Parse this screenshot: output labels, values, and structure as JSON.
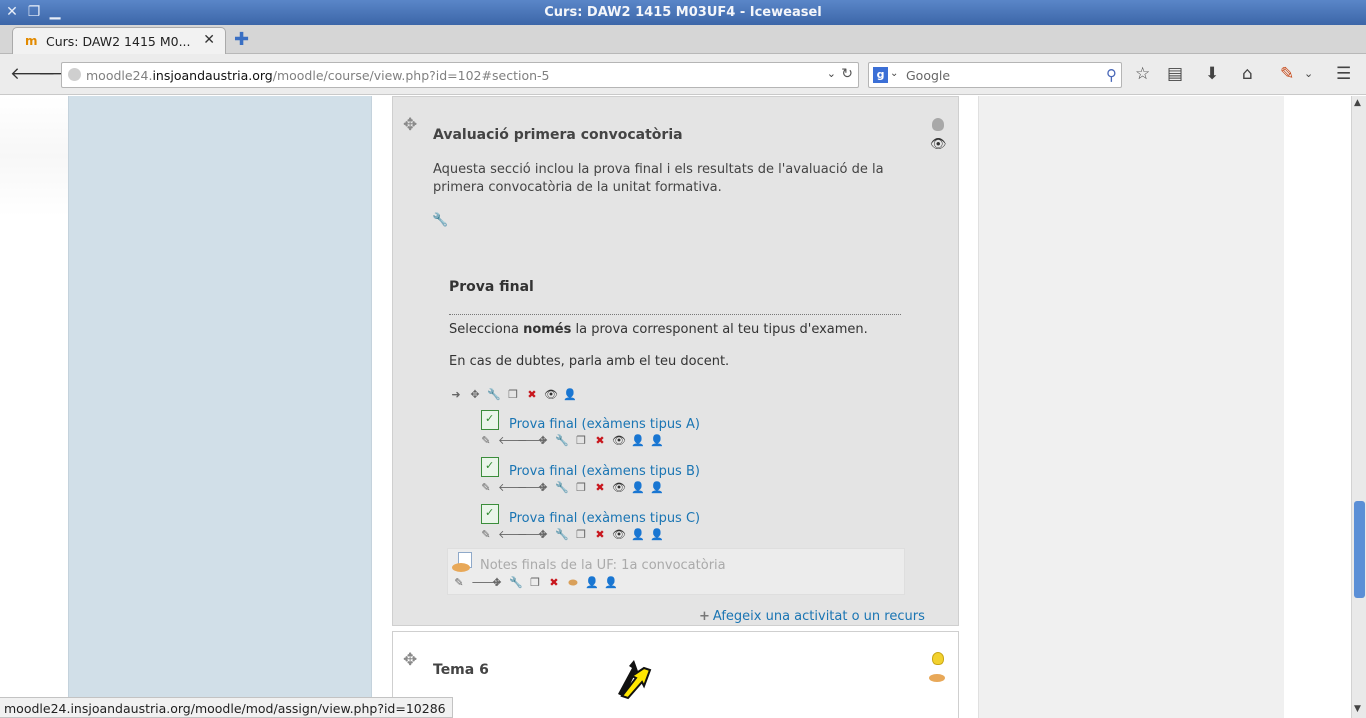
{
  "window": {
    "title": "Curs: DAW2 1415 M03UF4 - Iceweasel"
  },
  "tabs": [
    {
      "label": "Curs: DAW2 1415 M0...",
      "favicon": "moodle-icon"
    }
  ],
  "navbar": {
    "url_prefix": "moodle24.",
    "url_domain": "insjoandaustria.org",
    "url_path": "/moodle/course/view.php?id=102#section-5",
    "search_engine": "Google",
    "search_placeholder": "Google"
  },
  "section5": {
    "title": "Avaluació primera convocatòria",
    "summary": "Aquesta secció inclou la prova final i els resultats de l'avaluació de la primera convocatòria de la unitat formativa."
  },
  "label": {
    "title": "Prova final",
    "p1_before": "Selecciona ",
    "p1_bold": "només",
    "p1_after": " la prova corresponent al teu tipus d'examen.",
    "p2": "En cas de dubtes, parla amb el teu docent."
  },
  "activities": [
    {
      "name": "Prova final (exàmens tipus A)",
      "type": "quiz"
    },
    {
      "name": "Prova final (exàmens tipus B)",
      "type": "quiz"
    },
    {
      "name": "Prova final (exàmens tipus C)",
      "type": "quiz"
    },
    {
      "name": "Notes finals de la UF: 1a convocatòria",
      "type": "assign",
      "hidden": true
    }
  ],
  "add_activity_label": "Afegeix una activitat o un recurs",
  "section6": {
    "title": "Tema 6"
  },
  "statusbar": {
    "text": "moodle24.insjoandaustria.org/moodle/mod/assign/view.php?id=10286"
  },
  "scroll": {
    "position_fraction": 0.72
  },
  "colors": {
    "link": "#1a75b3",
    "sidebar_left": "#d1dfe8",
    "section_highlight": "#e4e4e4",
    "titlebar": "#4a76b8"
  }
}
